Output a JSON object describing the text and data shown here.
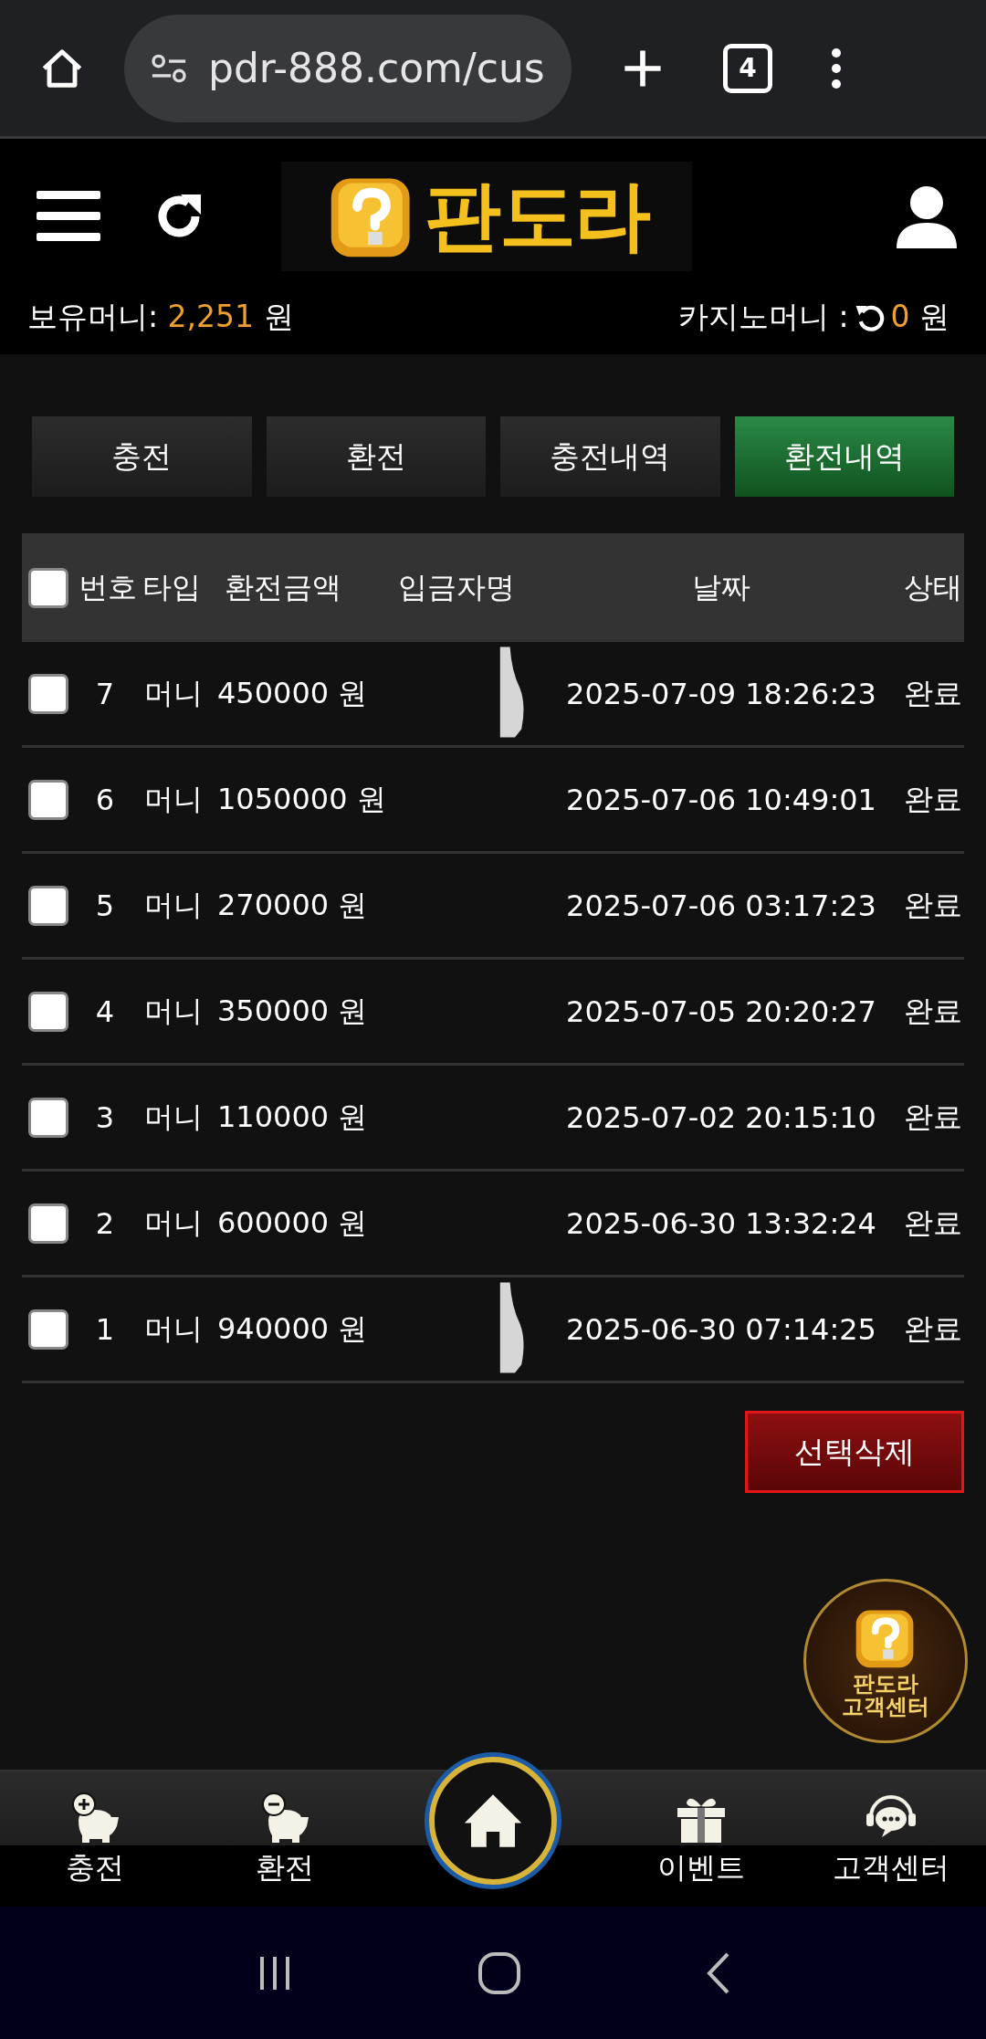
{
  "browser": {
    "url": "pdr-888.com/cus",
    "tab_count": "4"
  },
  "header": {
    "logo_text": "판도라",
    "balance_label": "보유머니:",
    "balance_value": "2,251",
    "balance_unit": "원",
    "casino_label": "카지노머니 :",
    "casino_value": "0",
    "casino_unit": "원"
  },
  "tabs": [
    {
      "label": "충전",
      "selected": false
    },
    {
      "label": "환전",
      "selected": false
    },
    {
      "label": "충전내역",
      "selected": false
    },
    {
      "label": "환전내역",
      "selected": true
    }
  ],
  "table": {
    "select_all_checked": false,
    "columns": [
      "번호",
      "타입",
      "환전금액",
      "입금자명",
      "날짜",
      "상태"
    ],
    "rows": [
      {
        "checked": false,
        "no": "7",
        "type": "머니",
        "amount": "450000 원",
        "redacted": true,
        "date": "2025-07-09 18:26:23",
        "status": "완료"
      },
      {
        "checked": false,
        "no": "6",
        "type": "머니",
        "amount": "1050000 원",
        "redacted": false,
        "date": "2025-07-06 10:49:01",
        "status": "완료"
      },
      {
        "checked": false,
        "no": "5",
        "type": "머니",
        "amount": "270000 원",
        "redacted": false,
        "date": "2025-07-06 03:17:23",
        "status": "완료"
      },
      {
        "checked": false,
        "no": "4",
        "type": "머니",
        "amount": "350000 원",
        "redacted": false,
        "date": "2025-07-05 20:20:27",
        "status": "완료"
      },
      {
        "checked": false,
        "no": "3",
        "type": "머니",
        "amount": "110000 원",
        "redacted": false,
        "date": "2025-07-02 20:15:10",
        "status": "완료"
      },
      {
        "checked": false,
        "no": "2",
        "type": "머니",
        "amount": "600000 원",
        "redacted": false,
        "date": "2025-06-30 13:32:24",
        "status": "완료"
      },
      {
        "checked": false,
        "no": "1",
        "type": "머니",
        "amount": "940000 원",
        "redacted": true,
        "date": "2025-06-30 07:14:25",
        "status": "완료"
      }
    ]
  },
  "delete_button": "선택삭제",
  "support_badge": [
    "판도라",
    "고객센터"
  ],
  "bottom_nav": [
    {
      "kind": "charge",
      "label": "충전"
    },
    {
      "kind": "withdraw",
      "label": "환전"
    },
    {
      "kind": "home"
    },
    {
      "kind": "event",
      "label": "이벤트"
    },
    {
      "kind": "support",
      "label": "고객센터"
    }
  ]
}
